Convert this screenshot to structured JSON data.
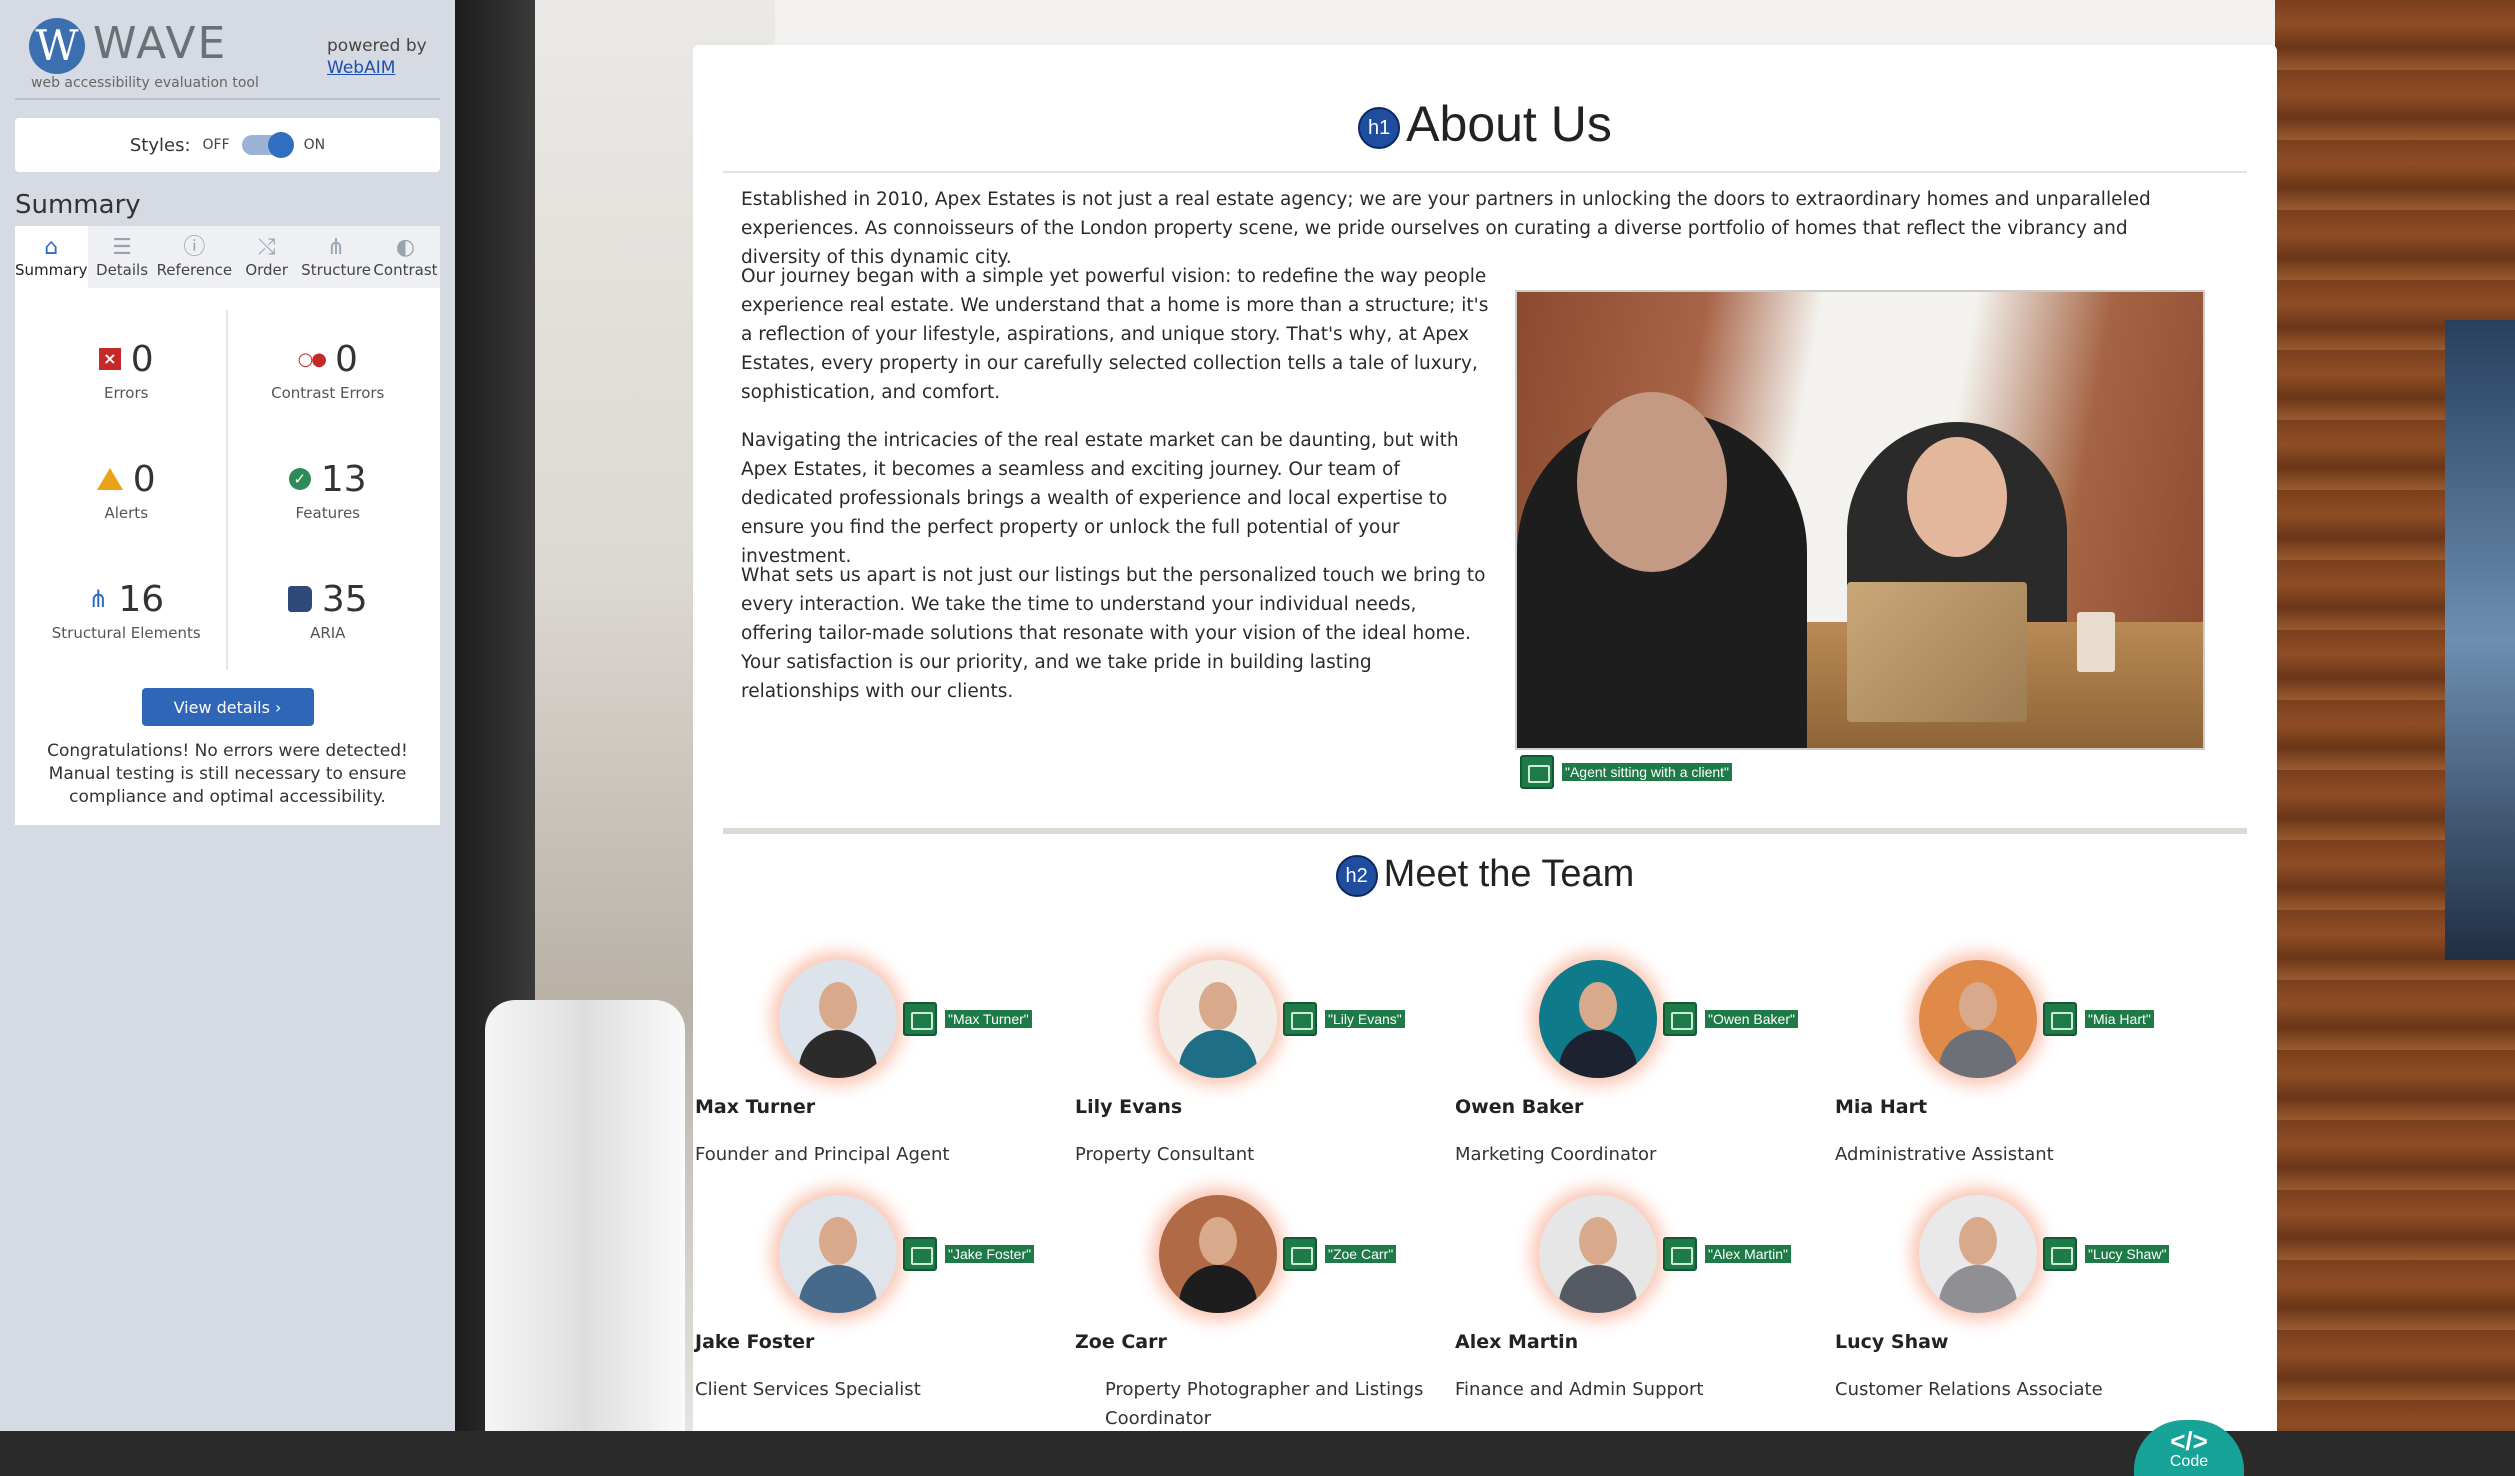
{
  "wave": {
    "logo_letter": "W",
    "name": "WAVE",
    "tagline": "web accessibility evaluation tool",
    "powered_by": "powered by",
    "webaim_link": "WebAIM",
    "styles_label": "Styles:",
    "toggle_off": "OFF",
    "toggle_on": "ON",
    "summary_title": "Summary",
    "tabs": [
      {
        "label": "Summary",
        "icon": "home-icon"
      },
      {
        "label": "Details",
        "icon": "list-icon"
      },
      {
        "label": "Reference",
        "icon": "info-icon"
      },
      {
        "label": "Order",
        "icon": "order-icon"
      },
      {
        "label": "Structure",
        "icon": "structure-icon"
      },
      {
        "label": "Contrast",
        "icon": "contrast-icon"
      }
    ],
    "stats": [
      {
        "count": "0",
        "label": "Errors"
      },
      {
        "count": "0",
        "label": "Contrast Errors"
      },
      {
        "count": "0",
        "label": "Alerts"
      },
      {
        "count": "13",
        "label": "Features"
      },
      {
        "count": "16",
        "label": "Structural Elements"
      },
      {
        "count": "35",
        "label": "ARIA"
      }
    ],
    "view_details": "View details ›",
    "congrats": "Congratulations! No errors were detected! Manual testing is still necessary to ensure compliance and optimal accessibility."
  },
  "page": {
    "h1_badge": "h1",
    "h1": "About Us",
    "paragraphs": [
      "Established in 2010, Apex Estates is not just a real estate agency; we are your partners in unlocking the doors to extraordinary homes and unparalleled experiences. As connoisseurs of the London property scene, we pride ourselves on curating a diverse portfolio of homes that reflect the vibrancy and diversity of this dynamic city.",
      "Our journey began with a simple yet powerful vision: to redefine the way people experience real estate. We understand that a home is more than a structure; it's a reflection of your lifestyle, aspirations, and unique story. That's why, at Apex Estates, every property in our carefully selected collection tells a tale of luxury, sophistication, and comfort.",
      "Navigating the intricacies of the real estate market can be daunting, but with Apex Estates, it becomes a seamless and exciting journey. Our team of dedicated professionals brings a wealth of experience and local expertise to ensure you find the perfect property or unlock the full potential of your investment.",
      "What sets us apart is not just our listings but the personalized touch we bring to every interaction. We take the time to understand your individual needs, offering tailor-made solutions that resonate with your vision of the ideal home. Your satisfaction is our priority, and we take pride in building lasting relationships with our clients."
    ],
    "photo_alt": "\"Agent sitting with a client\"",
    "h2_badge": "h2",
    "h2": "Meet the Team",
    "team": [
      {
        "alt": "\"Max Turner\"",
        "name": "Max Turner",
        "role": "Founder and Principal Agent",
        "shirt": "#2b2b2b",
        "bg": "#dde3ea"
      },
      {
        "alt": "\"Lily Evans\"",
        "name": "Lily Evans",
        "role": "Property Consultant",
        "shirt": "#1e6f86",
        "bg": "#f1ede6"
      },
      {
        "alt": "\"Owen Baker\"",
        "name": "Owen Baker",
        "role": "Marketing Coordinator",
        "shirt": "#1c2230",
        "bg": "#0f7a8a"
      },
      {
        "alt": "\"Mia Hart\"",
        "name": "Mia Hart",
        "role": "Administrative Assistant",
        "shirt": "#6e7078",
        "bg": "#e08a4a"
      },
      {
        "alt": "\"Jake Foster\"",
        "name": "Jake Foster",
        "role": "Client Services Specialist",
        "shirt": "#47698a",
        "bg": "#dfe4ea"
      },
      {
        "alt": "\"Zoe Carr\"",
        "name": "Zoe Carr",
        "role": "Property Photographer and Listings Coordinator",
        "shirt": "#1d1d1d",
        "bg": "#b06a45"
      },
      {
        "alt": "\"Alex Martin\"",
        "name": "Alex Martin",
        "role": "Finance and Admin Support",
        "shirt": "#555a63",
        "bg": "#e6e6e6"
      },
      {
        "alt": "\"Lucy Shaw\"",
        "name": "Lucy Shaw",
        "role": "Customer Relations Associate",
        "shirt": "#8f8f94",
        "bg": "#e9e9e9"
      }
    ],
    "code_glyph": "</>",
    "code_label": "Code"
  },
  "colors": {
    "wave_blue": "#2d6cc0",
    "alt_green": "#1e7a47",
    "code_teal": "#17a397"
  }
}
